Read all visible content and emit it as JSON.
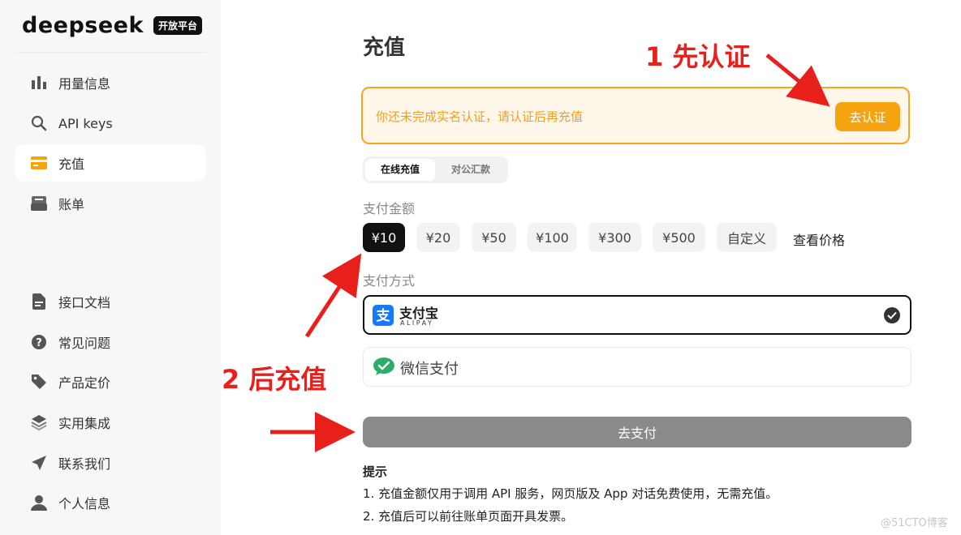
{
  "sidebar": {
    "logo_text": "deepseek",
    "logo_tag": "开放平台",
    "items": [
      {
        "label": "用量信息",
        "icon": "bar-chart-icon"
      },
      {
        "label": "API keys",
        "icon": "search-icon"
      },
      {
        "label": "充值",
        "icon": "card-icon"
      },
      {
        "label": "账单",
        "icon": "bill-icon"
      },
      {
        "label": "接口文档",
        "icon": "document-icon"
      },
      {
        "label": "常见问题",
        "icon": "question-icon"
      },
      {
        "label": "产品定价",
        "icon": "tag-icon"
      },
      {
        "label": "实用集成",
        "icon": "layers-icon"
      },
      {
        "label": "联系我们",
        "icon": "send-icon"
      },
      {
        "label": "个人信息",
        "icon": "user-icon"
      }
    ],
    "active_item": "充值"
  },
  "main": {
    "title": "充值",
    "warning": {
      "text": "你还未完成实名认证，请认证后再充值",
      "button": "去认证"
    },
    "tabs": {
      "online": "在线充值",
      "corporate": "对公汇款"
    },
    "amount_label": "支付金额",
    "amounts": [
      "¥10",
      "¥20",
      "¥50",
      "¥100",
      "¥300",
      "¥500",
      "自定义"
    ],
    "selected_amount": "¥10",
    "view_price": "查看价格",
    "method_label": "支付方式",
    "alipay": {
      "name": "支付宝",
      "sub": "ALIPAY"
    },
    "wechat": {
      "name": "微信支付"
    },
    "pay_button": "去支付",
    "tips": {
      "title": "提示",
      "line1": "1. 充值金额仅用于调用 API 服务，网页版及 App 对话免费使用，无需充值。",
      "line2": "2. 充值后可以前往账单页面开具发票。"
    }
  },
  "annotations": {
    "step1": "1 先认证",
    "step2": "2 后充值"
  },
  "watermark": "@51CTO博客",
  "colors": {
    "accent_orange": "#f5a30e",
    "warning_bg": "#fff6ea",
    "annotation_red": "#e8201c",
    "alipay_blue": "#1677ff",
    "wechat_green": "#2aae67"
  }
}
